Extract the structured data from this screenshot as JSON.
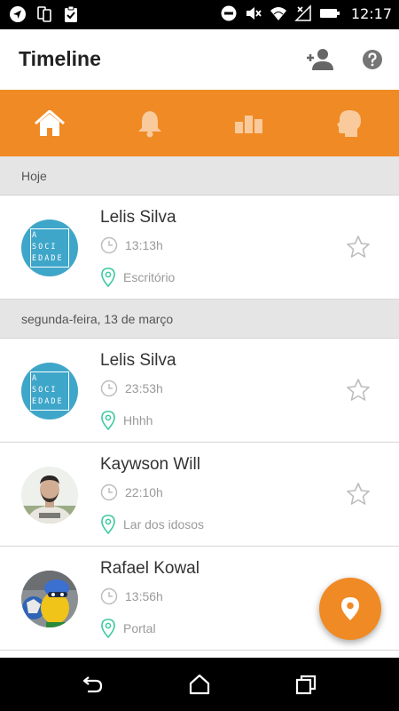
{
  "status_bar": {
    "time": "12:17",
    "left_icons": [
      "navigation-icon",
      "dual-sim-icon",
      "clipboard-check-icon"
    ],
    "right_icons": [
      "do-not-disturb-icon",
      "mute-icon",
      "wifi-icon",
      "no-signal-icon",
      "battery-icon"
    ]
  },
  "app_bar": {
    "title": "Timeline",
    "actions": [
      "add-person-icon",
      "help-icon"
    ]
  },
  "tabs": [
    {
      "name": "home",
      "icon": "home-icon",
      "active": true
    },
    {
      "name": "notifications",
      "icon": "bell-icon",
      "active": false
    },
    {
      "name": "stats",
      "icon": "bar-chart-icon",
      "active": false
    },
    {
      "name": "profile",
      "icon": "head-icon",
      "active": false
    }
  ],
  "sections": [
    {
      "header": "Hoje",
      "entries": [
        {
          "name": "Lelis Silva",
          "time": "13:13h",
          "place": "Escritório",
          "avatar": "a-sociedade-logo",
          "starred": false
        }
      ]
    },
    {
      "header": "segunda-feira, 13 de março",
      "entries": [
        {
          "name": "Lelis Silva",
          "time": "23:53h",
          "place": "Hhhh",
          "avatar": "a-sociedade-logo",
          "starred": false
        },
        {
          "name": "Kaywson Will",
          "time": "22:10h",
          "place": "Lar dos idosos",
          "avatar": "man-photo",
          "starred": false
        },
        {
          "name": "Rafael Kowal",
          "time": "13:56h",
          "place": "Portal",
          "avatar": "mascot-photo",
          "starred": false
        }
      ]
    }
  ],
  "soc_logo_text": "A SOCIEDADE",
  "fab": {
    "icon": "location-pin-icon"
  },
  "nav_bar": {
    "icons": [
      "back-icon",
      "home-outline-icon",
      "recent-apps-icon"
    ]
  },
  "colors": {
    "accent": "#f08a24",
    "section_header_bg": "#e5e5e5",
    "pin_green": "#3cc9a0",
    "soc_blue": "#3ea6c9"
  }
}
